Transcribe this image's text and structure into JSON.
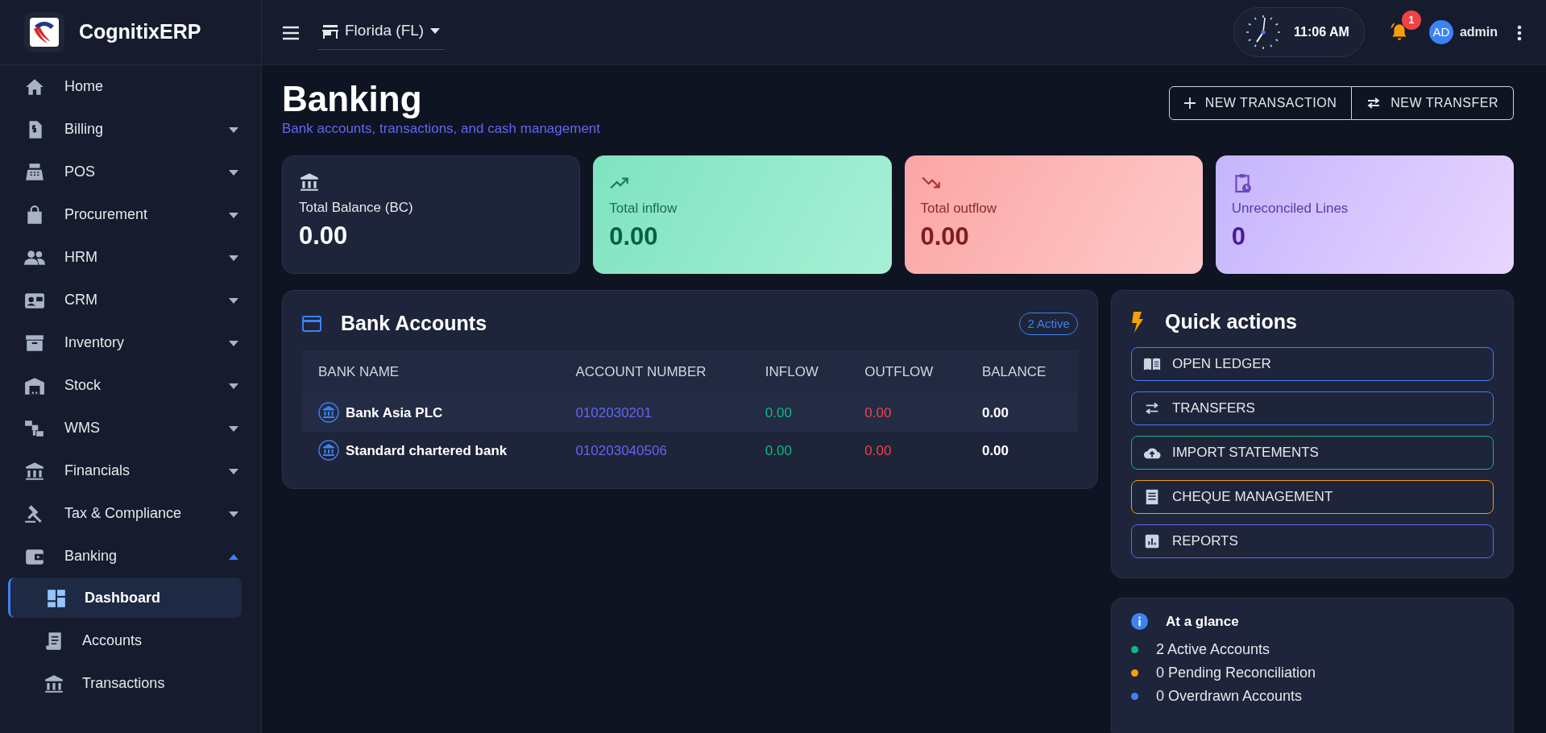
{
  "brand": {
    "name": "CognitixERP"
  },
  "sidebar": {
    "items": [
      {
        "label": "Home",
        "kind": "link"
      },
      {
        "label": "Billing",
        "kind": "group",
        "expanded": false
      },
      {
        "label": "POS",
        "kind": "group",
        "expanded": false
      },
      {
        "label": "Procurement",
        "kind": "group",
        "expanded": false
      },
      {
        "label": "HRM",
        "kind": "group",
        "expanded": false
      },
      {
        "label": "CRM",
        "kind": "group",
        "expanded": false
      },
      {
        "label": "Inventory",
        "kind": "group",
        "expanded": false
      },
      {
        "label": "Stock",
        "kind": "group",
        "expanded": false
      },
      {
        "label": "WMS",
        "kind": "group",
        "expanded": false
      },
      {
        "label": "Financials",
        "kind": "group",
        "expanded": false
      },
      {
        "label": "Tax & Compliance",
        "kind": "group",
        "expanded": false
      },
      {
        "label": "Banking",
        "kind": "group",
        "expanded": true,
        "children": [
          {
            "label": "Dashboard",
            "selected": true
          },
          {
            "label": "Accounts",
            "selected": false
          },
          {
            "label": "Transactions",
            "selected": false
          }
        ]
      }
    ]
  },
  "topbar": {
    "store": "Florida (FL)",
    "time": "11:06 AM",
    "notifications": "1",
    "user_initials": "AD",
    "user": "admin"
  },
  "page": {
    "title": "Banking",
    "subtitle": "Bank accounts, transactions, and cash management",
    "actions": [
      "NEW TRANSACTION",
      "NEW TRANSFER"
    ]
  },
  "stats": [
    {
      "label": "Total Balance (BC)",
      "value": "0.00",
      "kind": "neutral"
    },
    {
      "label": "Total inflow",
      "value": "0.00",
      "kind": "inflow"
    },
    {
      "label": "Total outflow",
      "value": "0.00",
      "kind": "outflow"
    },
    {
      "label": "Unreconciled Lines",
      "value": "0",
      "kind": "pending"
    }
  ],
  "accounts": {
    "title": "Bank Accounts",
    "badge": "2 Active",
    "table": {
      "columns": [
        "BANK NAME",
        "ACCOUNT NUMBER",
        "INFLOW",
        "OUTFLOW",
        "BALANCE"
      ],
      "rows": [
        {
          "bank": "Bank Asia PLC",
          "number": "0102030201",
          "inflow": "0.00",
          "outflow": "0.00",
          "balance": "0.00",
          "selected": true
        },
        {
          "bank": "Standard chartered bank",
          "number": "010203040506",
          "inflow": "0.00",
          "outflow": "0.00",
          "balance": "0.00",
          "selected": false
        }
      ]
    }
  },
  "quick_actions": {
    "title": "Quick actions",
    "items": [
      {
        "label": "OPEN LEDGER",
        "color": "#3b82f6"
      },
      {
        "label": "TRANSFERS",
        "color": "#3b82f6"
      },
      {
        "label": "IMPORT STATEMENTS",
        "color": "#10b981"
      },
      {
        "label": "CHEQUE MANAGEMENT",
        "color": "#f59e0b"
      },
      {
        "label": "REPORTS",
        "color": "#6366f1"
      }
    ]
  },
  "glance": {
    "title": "At a glance",
    "items": [
      {
        "text": "2 Active Accounts",
        "color": "#10b981"
      },
      {
        "text": "0 Pending Reconciliation",
        "color": "#f59e0b"
      },
      {
        "text": "0 Overdrawn Accounts",
        "color": "#3b82f6"
      }
    ]
  }
}
